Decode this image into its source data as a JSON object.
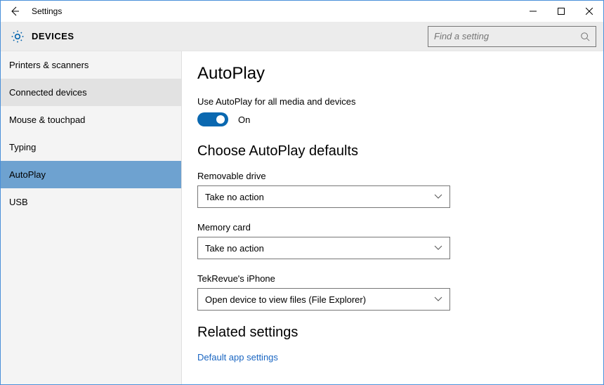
{
  "titlebar": {
    "title": "Settings"
  },
  "header": {
    "title": "DEVICES",
    "search_placeholder": "Find a setting"
  },
  "sidebar": {
    "items": [
      {
        "label": "Printers & scanners"
      },
      {
        "label": "Connected devices"
      },
      {
        "label": "Mouse & touchpad"
      },
      {
        "label": "Typing"
      },
      {
        "label": "AutoPlay"
      },
      {
        "label": "USB"
      }
    ]
  },
  "main": {
    "page_title": "AutoPlay",
    "use_autoplay_label": "Use AutoPlay for all media and devices",
    "toggle_state": "On",
    "defaults_heading": "Choose AutoPlay defaults",
    "groups": [
      {
        "label": "Removable drive",
        "value": "Take no action"
      },
      {
        "label": "Memory card",
        "value": "Take no action"
      },
      {
        "label": "TekRevue's iPhone",
        "value": "Open device to view files (File Explorer)"
      }
    ],
    "related_heading": "Related settings",
    "related_link": "Default app settings"
  }
}
